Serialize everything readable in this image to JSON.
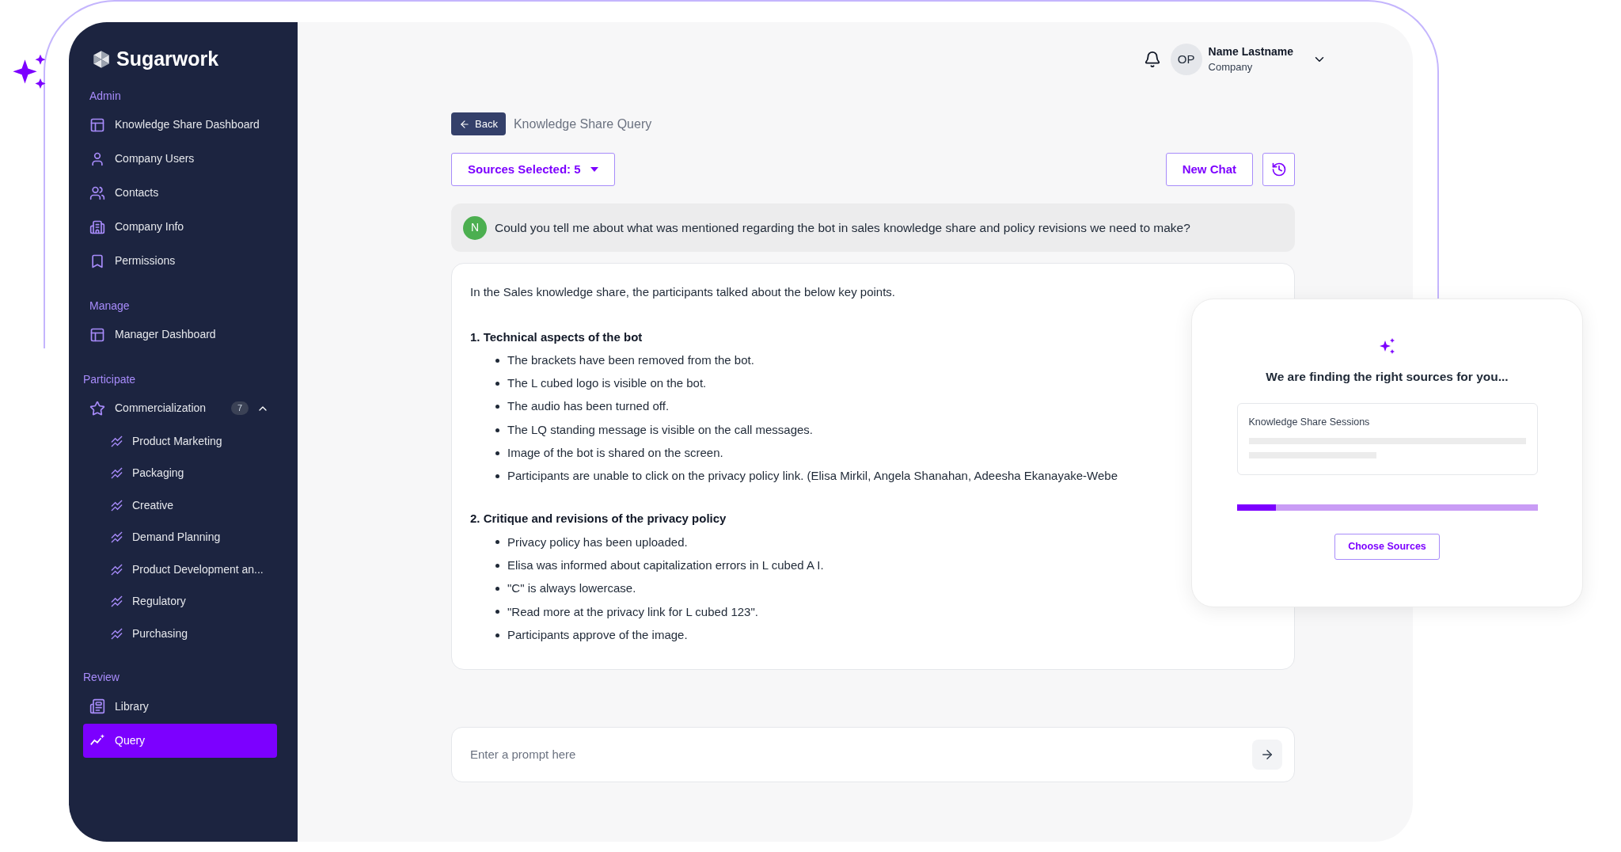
{
  "brand": {
    "name": "Sugarwork"
  },
  "sidebar": {
    "sections": [
      {
        "title": "Admin",
        "items": [
          {
            "label": "Knowledge Share Dashboard",
            "kind": "dashboard",
            "selected": false
          },
          {
            "label": "Company Users",
            "kind": "user",
            "selected": false
          },
          {
            "label": "Contacts",
            "kind": "users",
            "selected": false
          },
          {
            "label": "Company Info",
            "kind": "building",
            "selected": false
          },
          {
            "label": "Permissions",
            "kind": "bookmark",
            "selected": false
          }
        ]
      },
      {
        "title": "Manage",
        "items": [
          {
            "label": "Manager Dashboard",
            "kind": "dashboard",
            "selected": false
          }
        ]
      },
      {
        "title": "Participate",
        "items": [
          {
            "label": "Commercialization",
            "kind": "star",
            "selected": false,
            "badge": "7",
            "expanded": true,
            "children": [
              {
                "label": "Product Marketing",
                "selected": false
              },
              {
                "label": "Packaging",
                "selected": false
              },
              {
                "label": "Creative",
                "selected": false
              },
              {
                "label": "Demand Planning",
                "selected": false
              },
              {
                "label": "Product Development an...",
                "selected": false
              },
              {
                "label": "Regulatory",
                "selected": false
              },
              {
                "label": "Purchasing",
                "selected": false
              }
            ]
          }
        ]
      },
      {
        "title": "Review",
        "items": [
          {
            "label": "Library",
            "kind": "library",
            "selected": false
          },
          {
            "label": "Query",
            "kind": "query",
            "selected": true
          }
        ]
      }
    ]
  },
  "header": {
    "initials": "OP",
    "user_name": "Name Lastname",
    "company": "Company"
  },
  "breadcrumb": {
    "back": "Back",
    "title": "Knowledge Share Query"
  },
  "toolbar": {
    "sources": "Sources Selected: 5",
    "new_chat": "New Chat"
  },
  "question": {
    "avatar": "N",
    "text": "Could you tell me about what was mentioned regarding the bot in sales knowledge share and policy revisions we need to make?"
  },
  "answer": {
    "intro": "In the Sales knowledge share, the participants talked about the below key points.",
    "sections": [
      {
        "number": "1.",
        "heading": "Technical aspects of the bot",
        "bullets": [
          "The brackets have been removed from the bot.",
          "The L cubed logo is visible on the bot.",
          "The audio has been turned off.",
          "The LQ standing message is visible on the call messages.",
          "Image of the bot is shared on the screen.",
          "Participants are unable to click on the privacy policy link. (Elisa Mirkil, Angela Shanahan, Adeesha Ekanayake-Webe"
        ]
      },
      {
        "number": "2.",
        "heading": "Critique and revisions of the privacy policy",
        "bullets": [
          "Privacy policy has been uploaded.",
          "Elisa was informed about capitalization errors in L cubed A I.",
          "\"C\" is always lowercase.",
          "\"Read more at the privacy link for L cubed 123\".",
          "Participants approve of the image."
        ]
      }
    ]
  },
  "prompt": {
    "placeholder": "Enter a prompt here"
  },
  "popup": {
    "title": "We are finding the right sources for you...",
    "source_card": {
      "title": "Knowledge Share Sessions"
    },
    "progress": {
      "level": 0.13
    },
    "button": "Choose Sources"
  }
}
